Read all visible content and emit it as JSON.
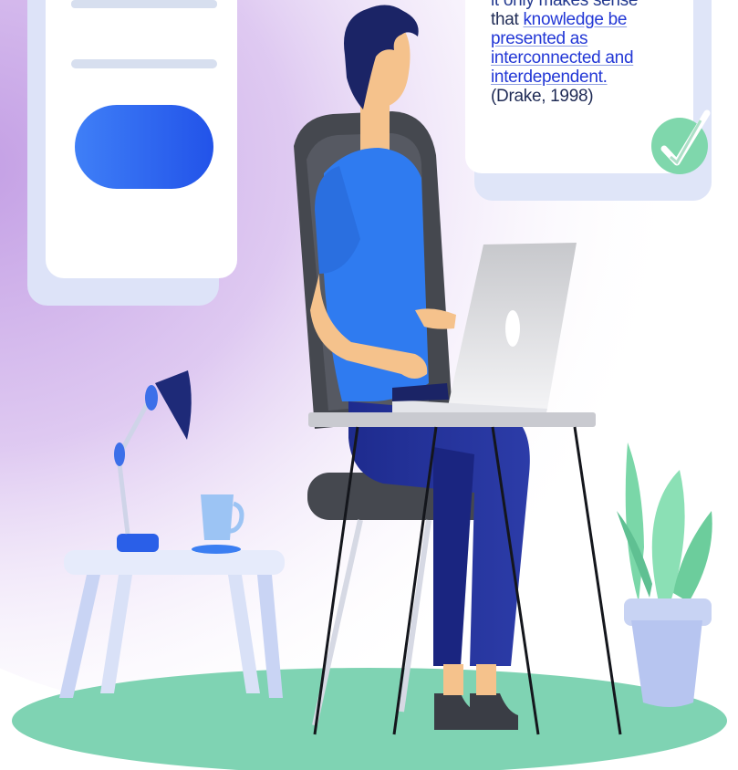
{
  "quote": {
    "line1": "it only makes sense",
    "line2_prefix": "that ",
    "line2_highlight": "knowledge be",
    "line3": "presented as",
    "line4": "interconnected and",
    "line5": "interdependent.",
    "citation": "(Drake, 1998)"
  },
  "colors": {
    "accent_blue": "#2f6ef5",
    "check_green": "#6fd1a6",
    "floor_green": "#7fd3b3",
    "purple_glow": "#c9a6e6",
    "navy": "#1e2a78"
  }
}
